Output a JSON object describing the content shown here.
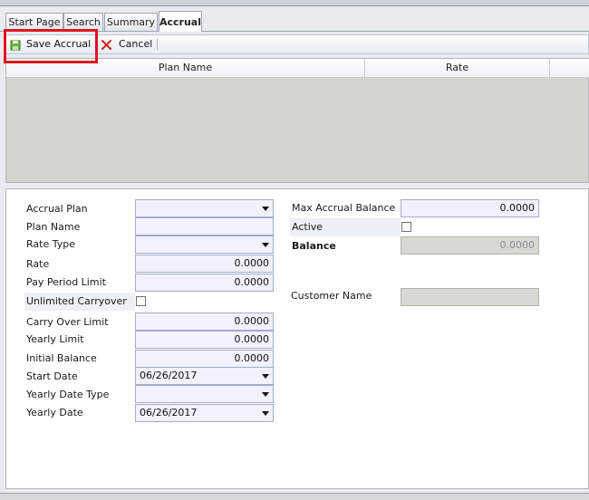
{
  "tabs": [
    "Start Page",
    "Search",
    "Summary",
    "Accrual"
  ],
  "toolbar": {
    "save_label": "Save Accrual",
    "cancel_label": "Cancel"
  },
  "grid": {
    "columns": [
      "Plan Name",
      "Rate"
    ]
  },
  "form": {
    "accrual_plan": {
      "label": "Accrual Plan",
      "value": ""
    },
    "plan_name": {
      "label": "Plan Name",
      "value": ""
    },
    "rate_type": {
      "label": "Rate Type",
      "value": ""
    },
    "rate": {
      "label": "Rate",
      "value": "0.0000"
    },
    "pay_period_limit": {
      "label": "Pay Period Limit",
      "value": "0.0000"
    },
    "unlimited_carryover": {
      "label": "Unlimited Carryover",
      "checked": false
    },
    "carry_over_limit": {
      "label": "Carry Over Limit",
      "value": "0.0000"
    },
    "yearly_limit": {
      "label": "Yearly Limit",
      "value": "0.0000"
    },
    "initial_balance": {
      "label": "Initial Balance",
      "value": "0.0000"
    },
    "start_date": {
      "label": "Start Date",
      "value": "06/26/2017"
    },
    "yearly_date_type": {
      "label": "Yearly Date Type",
      "value": ""
    },
    "yearly_date": {
      "label": "Yearly Date",
      "value": "06/26/2017"
    },
    "max_accrual_balance": {
      "label": "Max Accrual Balance",
      "value": "0.0000"
    },
    "active": {
      "label": "Active",
      "checked": false
    },
    "balance": {
      "label": "Balance",
      "value": "0.0000"
    },
    "customer_name": {
      "label": "Customer Name",
      "value": ""
    }
  },
  "colors": {
    "highlight": "#e0151d",
    "field_bg": "#f1f1ff",
    "readonly_bg": "#d9d9d4",
    "grid_bg": "#d4d4ce"
  },
  "icons": {
    "save": "save-accrual-icon",
    "cancel": "red-x-icon"
  }
}
